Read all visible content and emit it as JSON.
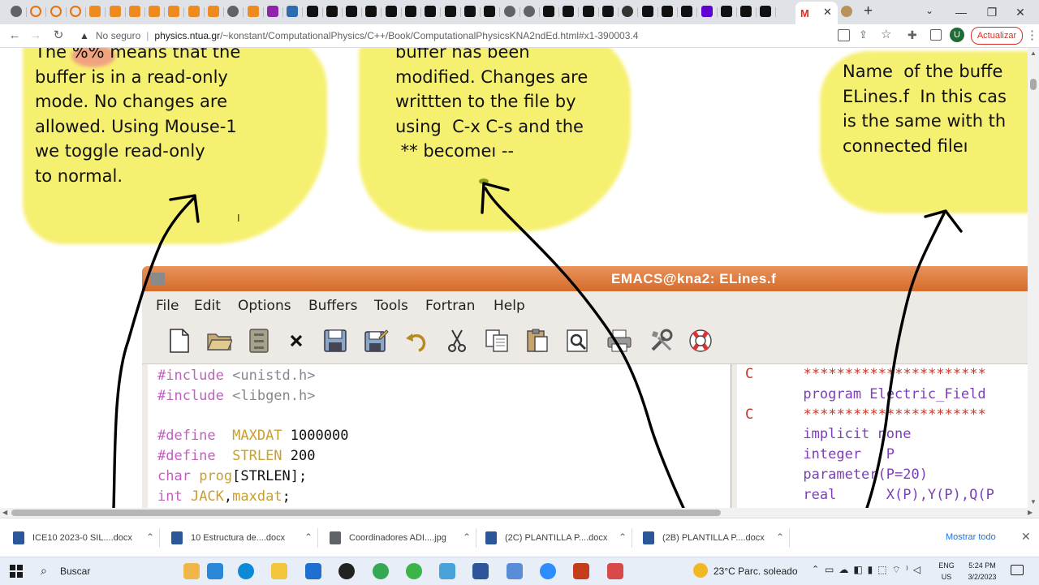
{
  "browser": {
    "address": {
      "security": "No seguro",
      "host": "physics.ntua.gr",
      "path": "/~konstant/ComputationalPhysics/C++/Book/ComputationalPhysicsKNA2ndEd.html#x1-390003.4"
    },
    "update_label": "Actualizar",
    "profile_letter": "U"
  },
  "notes": {
    "left": "The %% means that the\nbuffer is in a read-only\nmode. No changes are\nallowed. Using Mouse-1\nwe toggle read-only\nto normal.",
    "middle": "buffer has been\nmodified. Changes are\nwrittten to the file by\nusing  C-x C-s and the\n ** becomeı --",
    "right": "Name  of the buffe\nELines.f  In this cas\nis the same with th\nconnected fileı"
  },
  "emacs": {
    "title": "EMACS@kna2: ELines.f",
    "menu": [
      "File",
      "Edit",
      "Options",
      "Buffers",
      "Tools",
      "Fortran",
      "Help"
    ],
    "left_code": [
      {
        "a": "#include",
        "b": " <unistd.h>"
      },
      {
        "a": "#include",
        "b": " <libgen.h>"
      },
      {
        "a": "",
        "b": ""
      },
      {
        "a": "#define",
        "b": "  MAXDAT",
        "c": " 1000000"
      },
      {
        "a": "#define",
        "b": "  STRLEN",
        "c": " 200"
      },
      {
        "a": "char",
        "b": " prog",
        "c": "[STRLEN];"
      },
      {
        "a": "int",
        "b": " JACK",
        "c": ",",
        "d": "maxdat",
        "e": ";"
      }
    ],
    "right_code": [
      {
        "c": "C",
        "t": "      **********************"
      },
      {
        "c": "",
        "t": "      program Electric_Field"
      },
      {
        "c": "C",
        "t": "      **********************"
      },
      {
        "c": "",
        "t": "      implicit none"
      },
      {
        "c": "",
        "t": "      integer   P"
      },
      {
        "c": "",
        "t": "      parameter(P=20)"
      },
      {
        "c": "",
        "t": "      real      X(P),Y(P),Q(P"
      }
    ]
  },
  "downloads": [
    {
      "name": "ICE10 2023-0 SIL....docx",
      "color": "#2b579a"
    },
    {
      "name": "10 Estructura de....docx",
      "color": "#2b579a"
    },
    {
      "name": "Coordinadores ADI....jpg",
      "color": "#5f6368"
    },
    {
      "name": "(2C) PLANTILLA P....docx",
      "color": "#2b579a"
    },
    {
      "name": "(2B) PLANTILLA P....docx",
      "color": "#2b579a"
    }
  ],
  "downloads_show_all": "Mostrar todo",
  "taskbar": {
    "search_placeholder": "Buscar",
    "weather": "23°C  Parc. soleado",
    "lang_top": "ENG",
    "lang_bottom": "US",
    "time": "5:24 PM",
    "date": "3/2/2023"
  }
}
